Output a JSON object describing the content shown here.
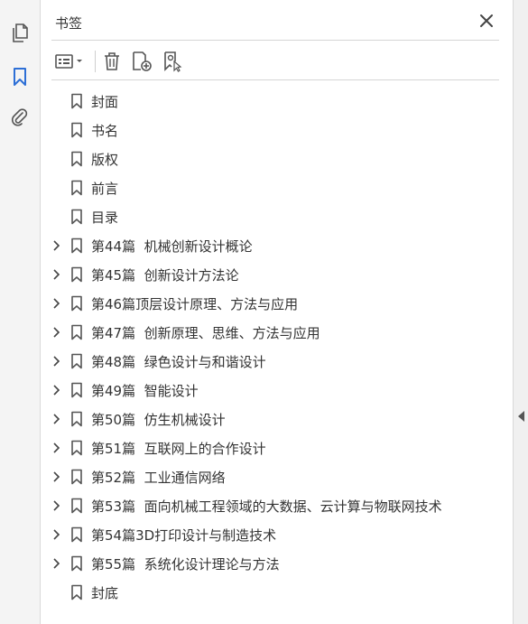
{
  "panel": {
    "title": "书签"
  },
  "rail": {
    "items": [
      {
        "icon": "pages-icon"
      },
      {
        "icon": "bookmark-icon",
        "active": true
      },
      {
        "icon": "attachment-icon"
      }
    ]
  },
  "toolbar": {
    "items": [
      {
        "icon": "options-menu-icon"
      },
      {
        "icon": "delete-icon"
      },
      {
        "icon": "new-bookmark-icon"
      },
      {
        "icon": "bookmark-from-selection-icon"
      }
    ]
  },
  "bookmarks": [
    {
      "label": "封面",
      "expandable": false
    },
    {
      "label": "书名",
      "expandable": false
    },
    {
      "label": "版权",
      "expandable": false
    },
    {
      "label": "前言",
      "expandable": false
    },
    {
      "label": "目录",
      "expandable": false
    },
    {
      "label": "第44篇  机械创新设计概论",
      "expandable": true
    },
    {
      "label": "第45篇  创新设计方法论",
      "expandable": true
    },
    {
      "label": "第46篇顶层设计原理、方法与应用",
      "expandable": true
    },
    {
      "label": "第47篇  创新原理、思维、方法与应用",
      "expandable": true
    },
    {
      "label": "第48篇  绿色设计与和谐设计",
      "expandable": true
    },
    {
      "label": "第49篇  智能设计",
      "expandable": true
    },
    {
      "label": "第50篇  仿生机械设计",
      "expandable": true
    },
    {
      "label": "第51篇  互联网上的合作设计",
      "expandable": true
    },
    {
      "label": "第52篇  工业通信网络",
      "expandable": true
    },
    {
      "label": "第53篇  面向机械工程领域的大数据、云计算与物联网技术",
      "expandable": true
    },
    {
      "label": "第54篇3D打印设计与制造技术",
      "expandable": true
    },
    {
      "label": "第55篇  系统化设计理论与方法",
      "expandable": true
    },
    {
      "label": "封底",
      "expandable": false
    }
  ],
  "colors": {
    "accent": "#2d6fd6",
    "icon": "#555555"
  }
}
